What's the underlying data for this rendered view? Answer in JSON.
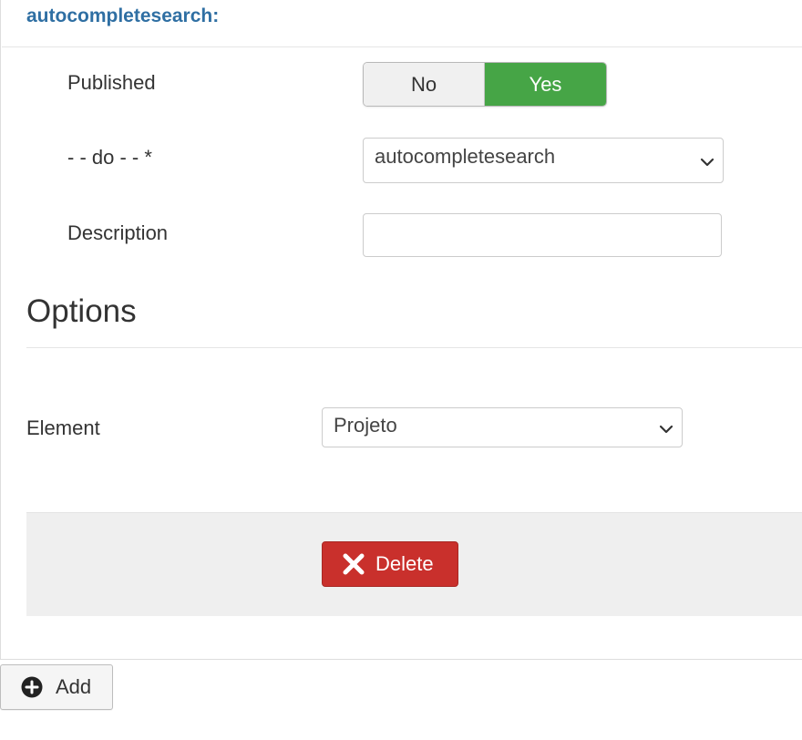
{
  "plugin": {
    "title": "autocompletesearch:"
  },
  "fields": {
    "published": {
      "label": "Published",
      "options": [
        "No",
        "Yes"
      ],
      "selected": "Yes"
    },
    "do": {
      "label": "- - do - - *",
      "value": "autocompletesearch"
    },
    "description": {
      "label": "Description",
      "value": ""
    }
  },
  "options_section": {
    "heading": "Options",
    "element": {
      "label": "Element",
      "value": "Projeto"
    }
  },
  "actions": {
    "delete_label": "Delete",
    "add_label": "Add"
  },
  "colors": {
    "title": "#2f6fa3",
    "yes_active": "#46a546",
    "delete": "#c9302c",
    "actions_bg": "#efefef"
  },
  "icons": {
    "delete": "close-icon",
    "add": "plus-circle-icon",
    "select": "chevron-down-icon"
  }
}
